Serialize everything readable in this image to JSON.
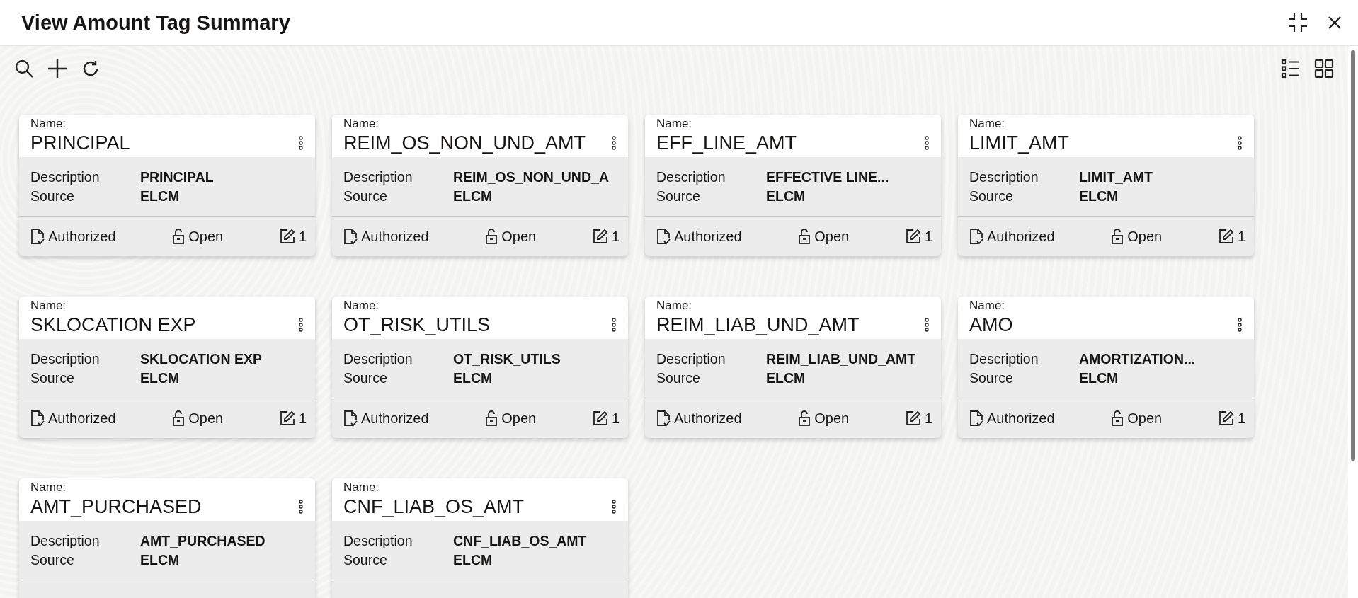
{
  "window": {
    "title": "View Amount Tag Summary"
  },
  "cards": [
    {
      "name_label": "Name:",
      "name": "PRINCIPAL",
      "description_label": "Description",
      "description": "PRINCIPAL",
      "source_label": "Source",
      "source": "ELCM",
      "status": "Authorized",
      "lock": "Open",
      "count": "1"
    },
    {
      "name_label": "Name:",
      "name": "REIM_OS_NON_UND_AMT",
      "description_label": "Description",
      "description": "REIM_OS_NON_UND_A",
      "source_label": "Source",
      "source": "ELCM",
      "status": "Authorized",
      "lock": "Open",
      "count": "1"
    },
    {
      "name_label": "Name:",
      "name": "EFF_LINE_AMT",
      "description_label": "Description",
      "description": "EFFECTIVE LINE...",
      "source_label": "Source",
      "source": "ELCM",
      "status": "Authorized",
      "lock": "Open",
      "count": "1"
    },
    {
      "name_label": "Name:",
      "name": "LIMIT_AMT",
      "description_label": "Description",
      "description": "LIMIT_AMT",
      "source_label": "Source",
      "source": "ELCM",
      "status": "Authorized",
      "lock": "Open",
      "count": "1"
    },
    {
      "name_label": "Name:",
      "name": "SKLOCATION EXP",
      "description_label": "Description",
      "description": "SKLOCATION EXP",
      "source_label": "Source",
      "source": "ELCM",
      "status": "Authorized",
      "lock": "Open",
      "count": "1"
    },
    {
      "name_label": "Name:",
      "name": "OT_RISK_UTILS",
      "description_label": "Description",
      "description": "OT_RISK_UTILS",
      "source_label": "Source",
      "source": "ELCM",
      "status": "Authorized",
      "lock": "Open",
      "count": "1"
    },
    {
      "name_label": "Name:",
      "name": "REIM_LIAB_UND_AMT",
      "description_label": "Description",
      "description": "REIM_LIAB_UND_AMT",
      "source_label": "Source",
      "source": "ELCM",
      "status": "Authorized",
      "lock": "Open",
      "count": "1"
    },
    {
      "name_label": "Name:",
      "name": "AMO",
      "description_label": "Description",
      "description": "AMORTIZATION...",
      "source_label": "Source",
      "source": "ELCM",
      "status": "Authorized",
      "lock": "Open",
      "count": "1"
    },
    {
      "name_label": "Name:",
      "name": "AMT_PURCHASED",
      "description_label": "Description",
      "description": "AMT_PURCHASED",
      "source_label": "Source",
      "source": "ELCM"
    },
    {
      "name_label": "Name:",
      "name": "CNF_LIAB_OS_AMT",
      "description_label": "Description",
      "description": "CNF_LIAB_OS_AMT",
      "source_label": "Source",
      "source": "ELCM"
    }
  ]
}
